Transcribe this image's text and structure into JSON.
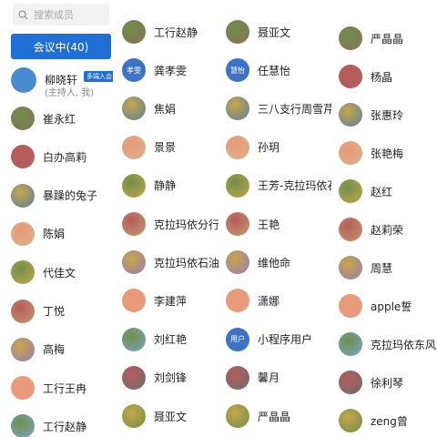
{
  "search": {
    "placeholder": "搜索成员"
  },
  "tab": {
    "label": "会议中(40)"
  },
  "host": {
    "name": "柳晓轩",
    "subtitle": "(主持人, 我)",
    "badge": "多端入会"
  },
  "avatar_colors": [
    "#5a7fa0",
    "#e89a7a",
    "#8c6f5a",
    "#c49a6c",
    "#6e8f4a",
    "#d9b28a",
    "#7aa6c8",
    "#b55c5c",
    "#9a7bb0",
    "#4f8c7a",
    "#c7a64a",
    "#6d6d6d"
  ],
  "col1": [
    {
      "name": "崔永红"
    },
    {
      "name": "白办高莉"
    },
    {
      "name": "暴躁的兔子"
    },
    {
      "name": "陈娟"
    },
    {
      "name": "代佳文"
    },
    {
      "name": "丁悦"
    },
    {
      "name": "高梅"
    },
    {
      "name": "工行王冉"
    },
    {
      "name": "工行赵静"
    }
  ],
  "col2": [
    {
      "name": "工行赵静"
    },
    {
      "name": "龚孝雯",
      "initials": "孝雯",
      "solid": "#3d73c7"
    },
    {
      "name": "焦娟"
    },
    {
      "name": "景景"
    },
    {
      "name": "静静"
    },
    {
      "name": "克拉玛依分行彭"
    },
    {
      "name": "克拉玛依石油分"
    },
    {
      "name": "李建萍"
    },
    {
      "name": "刘红艳"
    },
    {
      "name": "刘剑锋"
    },
    {
      "name": "聂亚文"
    }
  ],
  "col3": [
    {
      "name": "聂亚文"
    },
    {
      "name": "任慧怡",
      "initials": "慧怡",
      "solid": "#3d73c7"
    },
    {
      "name": "三八支行周雪芹"
    },
    {
      "name": "孙玥"
    },
    {
      "name": "王芳-克拉玛依石"
    },
    {
      "name": "王艳"
    },
    {
      "name": "维他命"
    },
    {
      "name": "潇娜"
    },
    {
      "name": "小程序用户",
      "initials": "用户",
      "solid": "#3d73c7"
    },
    {
      "name": "馨月"
    },
    {
      "name": "严晶晶"
    }
  ],
  "col4": [
    {
      "name": "严晶晶"
    },
    {
      "name": "杨晶"
    },
    {
      "name": "张惠玲"
    },
    {
      "name": "张艳梅"
    },
    {
      "name": "赵红"
    },
    {
      "name": "赵莉荣"
    },
    {
      "name": "周慧"
    },
    {
      "name": "apple誓"
    },
    {
      "name": "克拉玛依东风支"
    },
    {
      "name": "徐利琴"
    },
    {
      "name": "zeng曾"
    }
  ]
}
